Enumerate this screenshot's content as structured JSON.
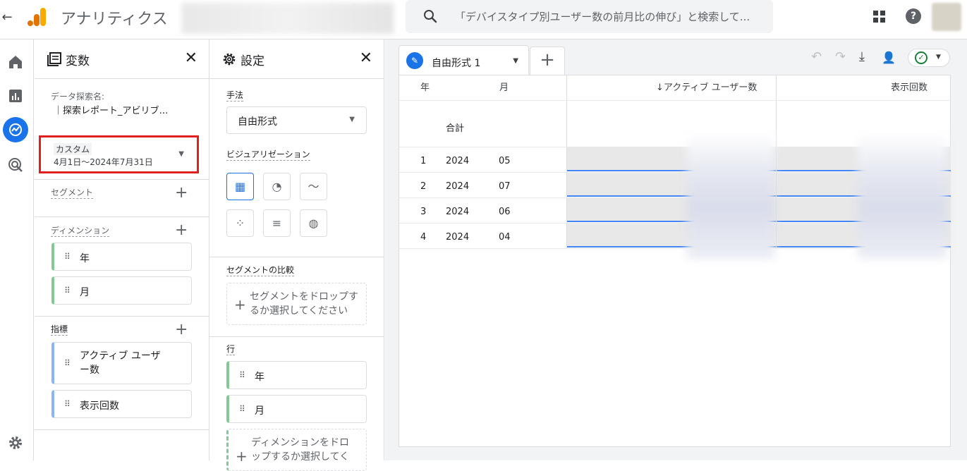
{
  "app": {
    "back_arrow": "←",
    "title": "アナリティクス"
  },
  "search": {
    "placeholder": "「デバイスタイプ別ユーザー数の前月比の伸び」と検索して..."
  },
  "header_icons": {
    "help": "?"
  },
  "variables_panel": {
    "title": "変数",
    "exploration_name_label": "データ探索名:",
    "exploration_name_value": "｜探索レポート_アビリブ…",
    "date_tag": "カスタム",
    "date_range": "4月1日～2024年7月31日",
    "segments_label": "セグメント",
    "dimensions_label": "ディメンション",
    "dimensions": [
      "年",
      "月"
    ],
    "metrics_label": "指標",
    "metrics": [
      "アクティブ ユーザ\nー数",
      "表示回数"
    ]
  },
  "settings_panel": {
    "title": "設定",
    "technique_label": "手法",
    "technique_value": "自由形式",
    "viz_label": "ビジュアリゼーション",
    "segment_compare_label": "セグメントの比較",
    "segment_drop_text": "セグメントをドロップするか選択してください",
    "rows_label": "行",
    "rows": [
      "年",
      "月"
    ],
    "dimension_drop_text": "ディメンションをドロップするか選択してく"
  },
  "canvas": {
    "tab_label": "自由形式 1",
    "tab_add": "+",
    "table": {
      "headers": {
        "year": "年",
        "month": "月",
        "active_users": "↓アクティブ ユーザー数",
        "views": "表示回数"
      },
      "total_label": "合計",
      "rows": [
        {
          "idx": "1",
          "year": "2024",
          "month": "05"
        },
        {
          "idx": "2",
          "year": "2024",
          "month": "07"
        },
        {
          "idx": "3",
          "year": "2024",
          "month": "06"
        },
        {
          "idx": "4",
          "year": "2024",
          "month": "04"
        }
      ]
    }
  },
  "colors": {
    "accent": "#1a73e8",
    "highlight_red": "#e0201e",
    "dimension_green": "#81c995",
    "metric_blue": "#8ab4f8"
  }
}
